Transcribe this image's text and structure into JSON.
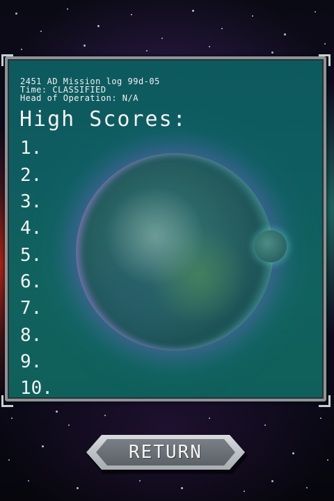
{
  "log": {
    "line1": "2451 AD Mission log 99d-05",
    "line2": "Time: CLASSIFIED",
    "line3": "Head of Operation: N/A"
  },
  "title": "High Scores:",
  "scores": [
    {
      "rank": "1.",
      "name": "",
      "score": ""
    },
    {
      "rank": "2.",
      "name": "",
      "score": ""
    },
    {
      "rank": "3.",
      "name": "",
      "score": ""
    },
    {
      "rank": "4.",
      "name": "",
      "score": ""
    },
    {
      "rank": "5.",
      "name": "",
      "score": ""
    },
    {
      "rank": "6.",
      "name": "",
      "score": ""
    },
    {
      "rank": "7.",
      "name": "",
      "score": ""
    },
    {
      "rank": "8.",
      "name": "",
      "score": ""
    },
    {
      "rank": "9.",
      "name": "",
      "score": ""
    },
    {
      "rank": "10.",
      "name": "",
      "score": ""
    }
  ],
  "return_button": {
    "label": "RETURN"
  },
  "colors": {
    "panel": "#0f5c60",
    "frame": "#8d9498",
    "text": "#f4f4f4"
  }
}
